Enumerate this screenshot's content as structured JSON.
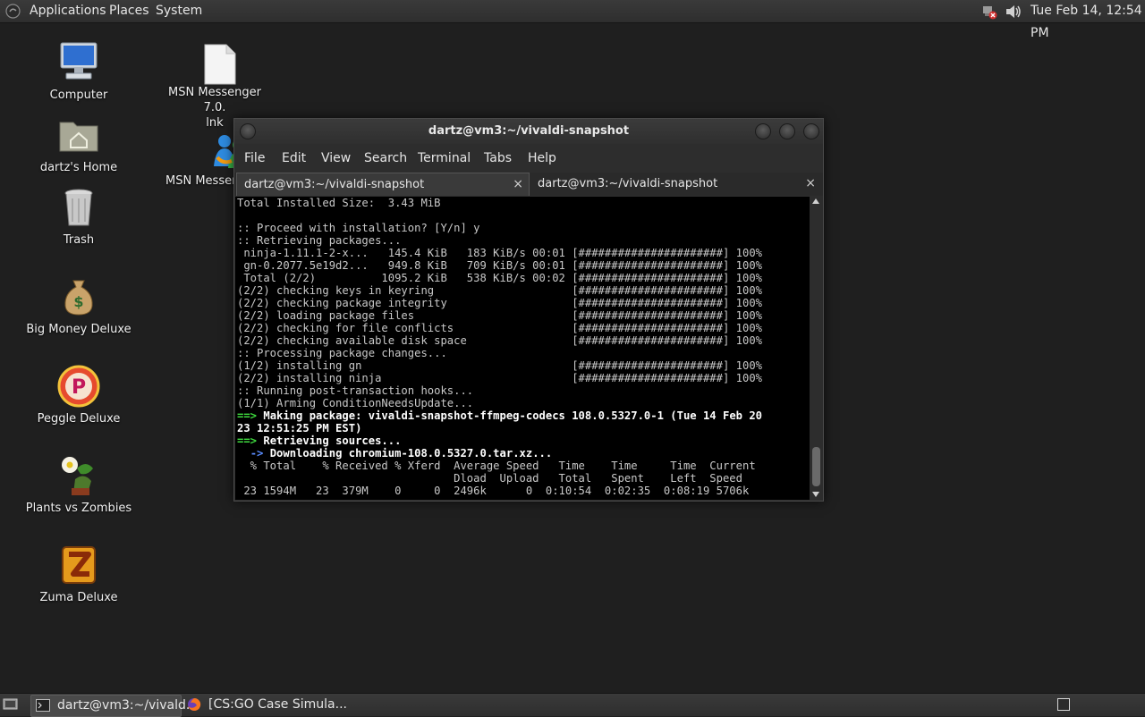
{
  "top_panel": {
    "menus": {
      "applications": "Applications",
      "places": "Places",
      "system": "System"
    },
    "clock": "Tue Feb 14, 12:54 PM",
    "icons": {
      "logo": "gnome-foot-icon",
      "network": "network-error-icon",
      "volume": "speaker-icon"
    }
  },
  "desktop": {
    "icons": [
      {
        "label": "Computer",
        "icon": "computer-icon"
      },
      {
        "label": "dartz's Home",
        "icon": "home-folder-icon"
      },
      {
        "label": "Trash",
        "icon": "trash-icon"
      },
      {
        "label": "Big Money Deluxe",
        "icon": "money-bag-icon"
      },
      {
        "label": "Peggle Deluxe",
        "icon": "peggle-icon"
      },
      {
        "label": "Plants vs Zombies",
        "icon": "plants-vs-zombies-icon"
      },
      {
        "label": "Zuma Deluxe",
        "icon": "zuma-icon"
      },
      {
        "label": "MSN Messenger 7.0.\nlnk",
        "icon": "file-icon"
      },
      {
        "label": "MSN Messen",
        "icon": "msn-messenger-icon"
      }
    ]
  },
  "terminal": {
    "title": "dartz@vm3:~/vivaldi-snapshot",
    "menu": [
      "File",
      "Edit",
      "View",
      "Search",
      "Terminal",
      "Tabs",
      "Help"
    ],
    "tabs": [
      {
        "label": "dartz@vm3:~/vivaldi-snapshot",
        "close": "×"
      },
      {
        "label": "dartz@vm3:~/vivaldi-snapshot",
        "close": "×"
      }
    ],
    "lines": [
      "Total Installed Size:  3.43 MiB",
      "",
      ":: Proceed with installation? [Y/n] y",
      ":: Retrieving packages...",
      " ninja-1.11.1-2-x...   145.4 KiB   183 KiB/s 00:01 [######################] 100%",
      " gn-0.2077.5e19d2...   949.8 KiB   709 KiB/s 00:01 [######################] 100%",
      " Total (2/2)          1095.2 KiB   538 KiB/s 00:02 [######################] 100%",
      "(2/2) checking keys in keyring                     [######################] 100%",
      "(2/2) checking package integrity                   [######################] 100%",
      "(2/2) loading package files                        [######################] 100%",
      "(2/2) checking for file conflicts                  [######################] 100%",
      "(2/2) checking available disk space                [######################] 100%",
      ":: Processing package changes...",
      "(1/2) installing gn                                [######################] 100%",
      "(2/2) installing ninja                             [######################] 100%",
      ":: Running post-transaction hooks...",
      "(1/1) Arming ConditionNeedsUpdate...",
      "==> Making package: vivaldi-snapshot-ffmpeg-codecs 108.0.5327.0-1 (Tue 14 Feb 20",
      "23 12:51:25 PM EST)",
      "==> Retrieving sources...",
      "  -> Downloading chromium-108.0.5327.0.tar.xz...",
      "  % Total    % Received % Xferd  Average Speed   Time    Time     Time  Current",
      "                                 Dload  Upload   Total   Spent    Left  Speed",
      " 23 1594M   23  379M    0     0  2496k      0  0:10:54  0:02:35  0:08:19 5706k"
    ]
  },
  "taskbar": {
    "tasks": [
      {
        "label": "dartz@vm3:~/vivald...",
        "icon": "terminal-icon"
      },
      {
        "label": "[CS:GO Case Simula...",
        "icon": "firefox-icon"
      }
    ]
  },
  "colors": {
    "panel": "#333333",
    "desktop": "#1f1f1f",
    "terminal_bg": "#000000",
    "prompt_green": "#3fdc3f",
    "arrow_blue": "#5a8cff"
  }
}
